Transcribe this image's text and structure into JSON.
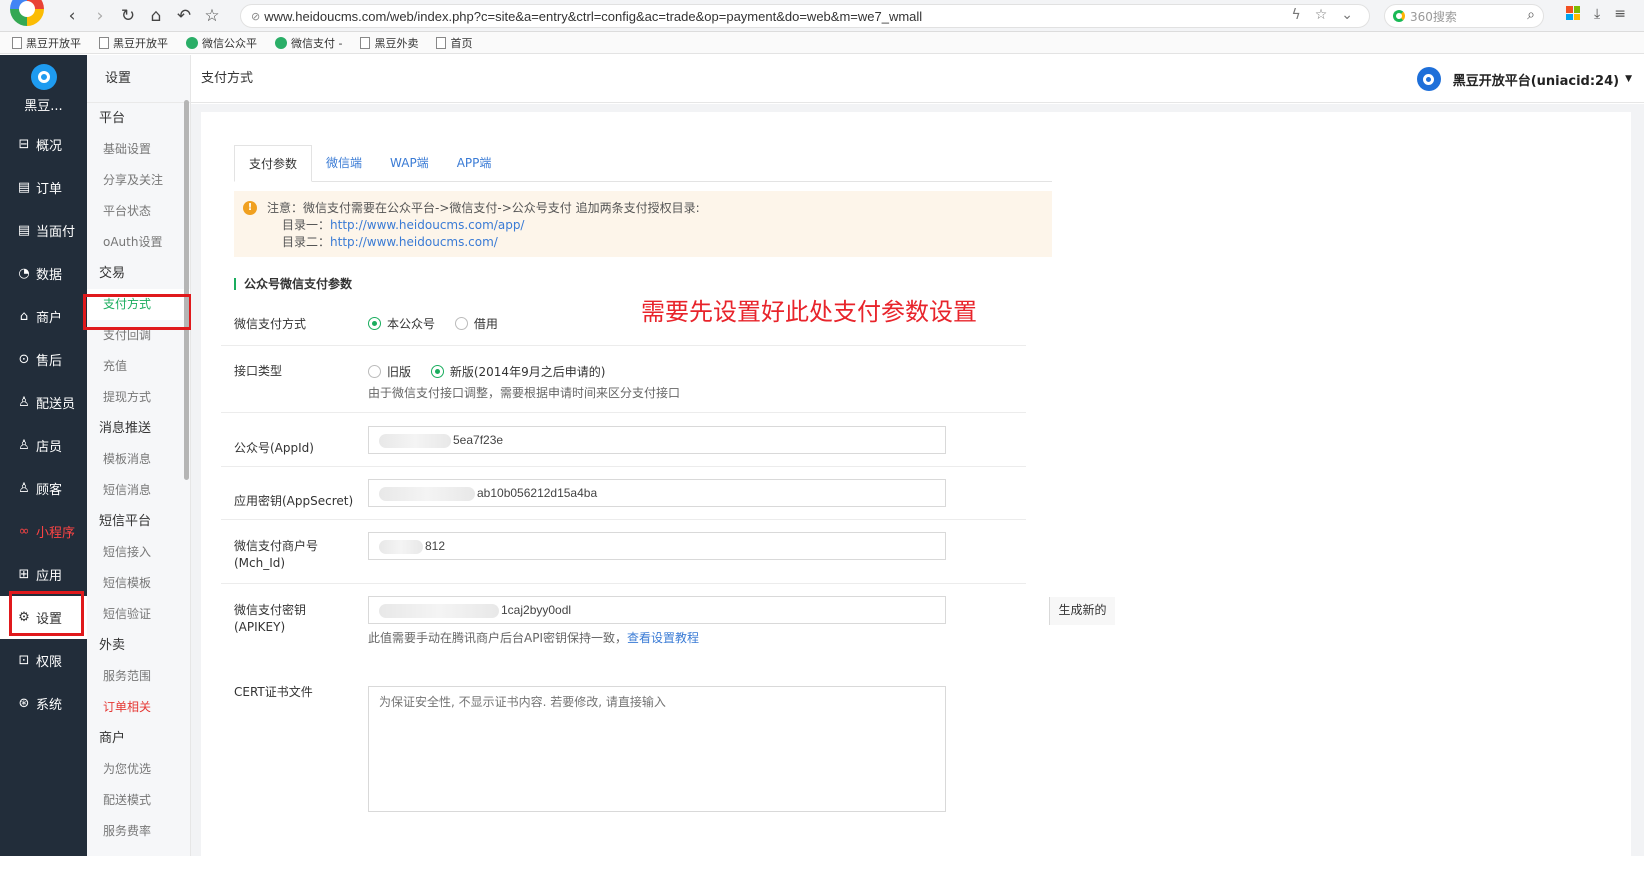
{
  "browser": {
    "url": "www.heidoucms.com/web/index.php?c=site&a=entry&ctrl=config&ac=trade&op=payment&do=web&m=we7_wmall",
    "search_placeholder": "360搜索"
  },
  "bookmarks": [
    "黑豆开放平",
    "黑豆开放平",
    "微信公众平",
    "微信支付 -",
    "黑豆外卖",
    "首页"
  ],
  "brand": {
    "name": "黑豆..."
  },
  "sidebar": {
    "items": [
      {
        "label": "概况",
        "icon": "dashboard-icon"
      },
      {
        "label": "订单",
        "icon": "order-icon"
      },
      {
        "label": "当面付",
        "icon": "receipt-icon"
      },
      {
        "label": "数据",
        "icon": "chart-icon"
      },
      {
        "label": "商户",
        "icon": "shop-icon"
      },
      {
        "label": "售后",
        "icon": "service-icon"
      },
      {
        "label": "配送员",
        "icon": "courier-icon"
      },
      {
        "label": "店员",
        "icon": "clerk-icon"
      },
      {
        "label": "顾客",
        "icon": "customer-icon"
      },
      {
        "label": "小程序",
        "icon": "miniprogram-icon"
      },
      {
        "label": "应用",
        "icon": "apps-icon"
      },
      {
        "label": "设置",
        "icon": "gear-icon"
      },
      {
        "label": "权限",
        "icon": "lock-icon"
      },
      {
        "label": "系统",
        "icon": "system-icon"
      }
    ]
  },
  "submenu": {
    "title": "设置",
    "groups": [
      {
        "title": "平台",
        "items": [
          "基础设置",
          "分享及关注",
          "平台状态",
          "oAuth设置"
        ]
      },
      {
        "title": "交易",
        "items": [
          "支付方式",
          "支付回调",
          "充值",
          "提现方式"
        ]
      },
      {
        "title": "消息推送",
        "items": [
          "模板消息",
          "短信消息"
        ]
      },
      {
        "title": "短信平台",
        "items": [
          "短信接入",
          "短信模板",
          "短信验证"
        ]
      },
      {
        "title": "外卖",
        "items": [
          "服务范围",
          "订单相关"
        ]
      },
      {
        "title": "商户",
        "items": [
          "为您优选",
          "配送模式",
          "服务费率"
        ]
      }
    ]
  },
  "header": {
    "title": "支付方式",
    "account": "黑豆开放平台(uniacid:24)"
  },
  "tabs": [
    "支付参数",
    "微信端",
    "WAP端",
    "APP端"
  ],
  "notice": {
    "line1": "注意：微信支付需要在公众平台->微信支付->公众号支付 追加两条支付授权目录:",
    "dir1_label": "目录一：",
    "dir1_url": "http://www.heidoucms.com/app/",
    "dir2_label": "目录二：",
    "dir2_url": "http://www.heidoucms.com/"
  },
  "section_title": "公众号微信支付参数",
  "annotation": "需要先设置好此处支付参数设置",
  "form": {
    "pay_mode": {
      "label": "微信支付方式",
      "options": [
        "本公众号",
        "借用"
      ],
      "selected": "本公众号"
    },
    "api_type": {
      "label": "接口类型",
      "options": [
        "旧版",
        "新版(2014年9月之后申请的)"
      ],
      "selected": "新版(2014年9月之后申请的)",
      "help": "由于微信支付接口调整，需要根据申请时间来区分支付接口"
    },
    "appid": {
      "label": "公众号(AppId)",
      "value_visible": "5ea7f23e"
    },
    "appsecret": {
      "label": "应用密钥(AppSecret)",
      "value_visible": "ab10b056212d15a4ba"
    },
    "mchid": {
      "label1": "微信支付商户号",
      "label2": "(Mch_Id)",
      "value_visible": "812"
    },
    "apikey": {
      "label1": "微信支付密钥",
      "label2": "(APIKEY)",
      "value_visible": "1caj2byy0odl",
      "button": "生成新的",
      "help": "此值需要手动在腾讯商户后台API密钥保持一致，",
      "help_link": "查看设置教程"
    },
    "cert": {
      "label": "CERT证书文件",
      "placeholder": "为保证安全性, 不显示证书内容. 若要修改, 请直接输入"
    }
  },
  "colors": {
    "sidebar_bg": "#222d3a",
    "accent_green": "#1aad5e",
    "link_blue": "#3a7bd5",
    "highlight_red": "#e0191c"
  }
}
